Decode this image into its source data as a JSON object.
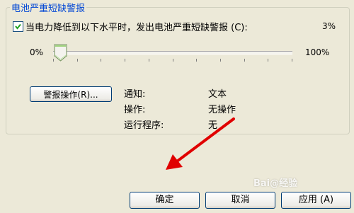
{
  "group": {
    "title": "电池严重短缺警报"
  },
  "checkbox": {
    "label": "当电力降低到以下水平时，发出电池严重短缺警报 (C):",
    "checked": true
  },
  "level": {
    "value_text": "3%",
    "value_percent": 3
  },
  "slider": {
    "min_label": "0%",
    "max_label": "100%"
  },
  "alarm_button": {
    "label": "警报操作(R)..."
  },
  "info": [
    {
      "label": "通知:",
      "value": "文本"
    },
    {
      "label": "操作:",
      "value": "无操作"
    },
    {
      "label": "运行程序:",
      "value": "无"
    }
  ],
  "buttons": {
    "ok": "确定",
    "cancel": "取消",
    "apply": "应用 (A)"
  },
  "watermark": {
    "text": "Bai@经验"
  },
  "colors": {
    "title_blue": "#0046d5",
    "arrow_red": "#e00000",
    "bg": "#ece9d8"
  }
}
